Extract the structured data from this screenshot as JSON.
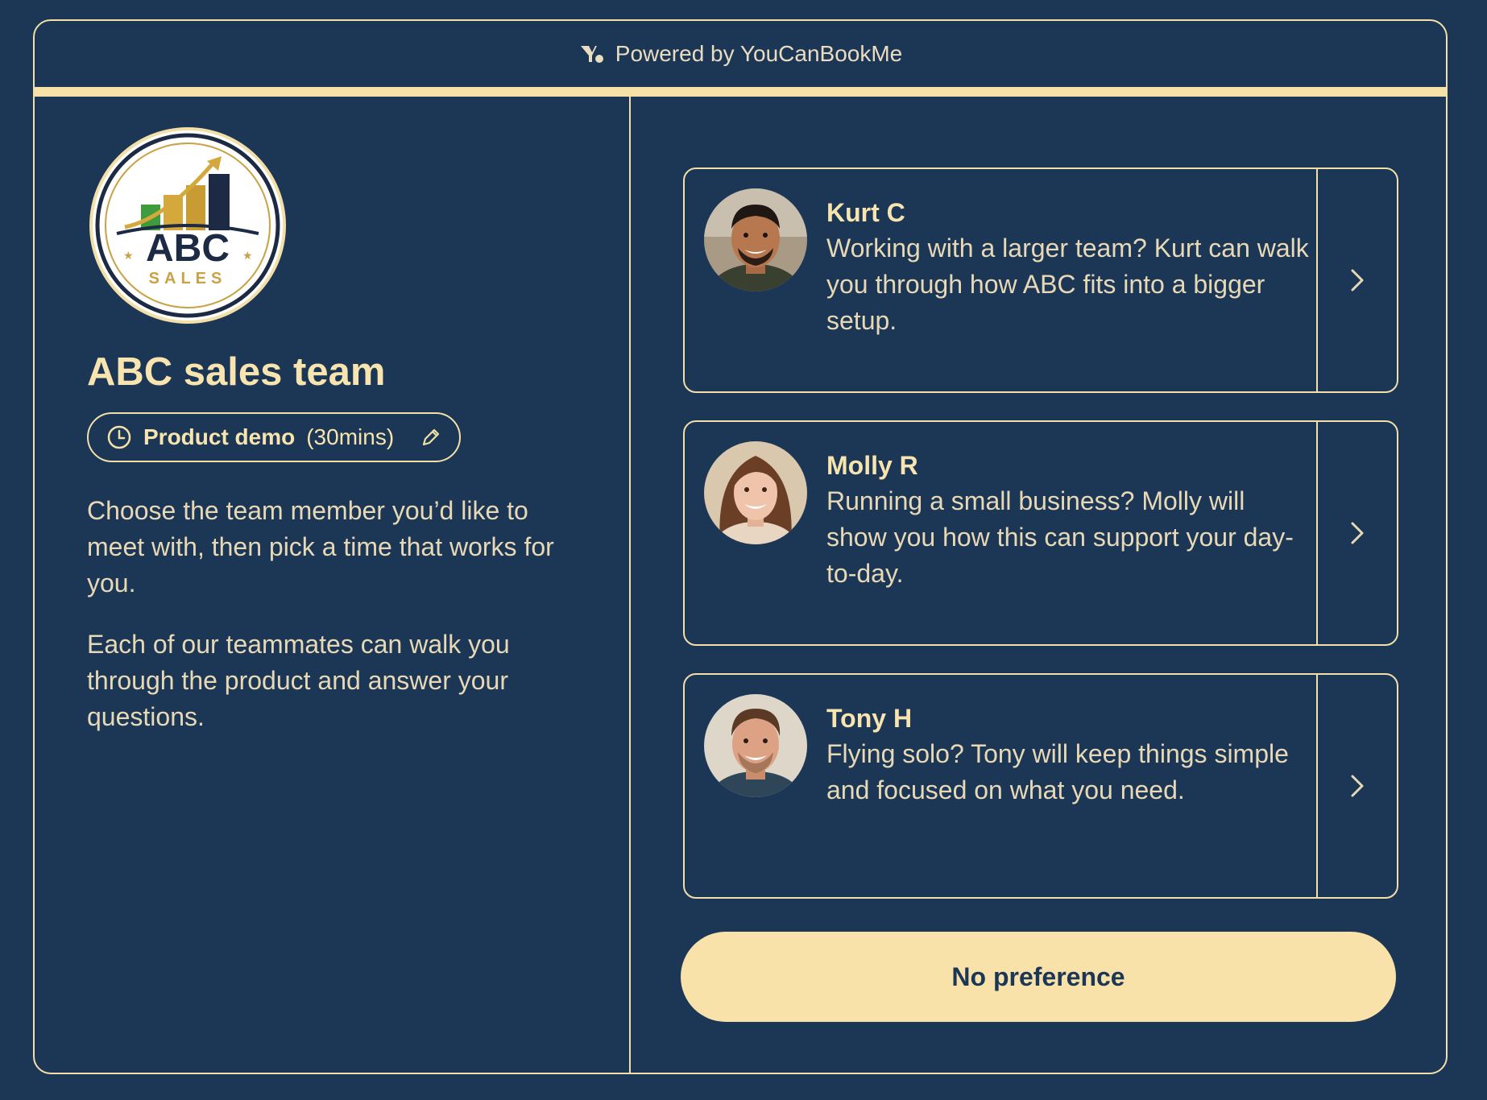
{
  "header": {
    "powered_by": "Powered by YouCanBookMe",
    "icon": "youcanbookme-logo-icon"
  },
  "brand": {
    "logo_text": "ABC",
    "logo_subtext": "SALES"
  },
  "left": {
    "title": "ABC sales team",
    "meeting_type": {
      "name": "Product demo",
      "duration": "(30mins)",
      "clock_icon": "clock-icon",
      "edit_icon": "pencil-icon"
    },
    "paragraph_1": "Choose the team member you’d like to meet with, then pick a time that works for you.",
    "paragraph_2": "Each of our teammates can walk you through the product and answer your questions."
  },
  "members": [
    {
      "name": "Kurt C",
      "description": "Working with a larger team? Kurt can walk you through how ABC fits into a bigger setup."
    },
    {
      "name": "Molly R",
      "description": "Running a small business? Molly will show you how this can support your day-to-day."
    },
    {
      "name": "Tony H",
      "description": "Flying solo? Tony will keep things simple and focused on what you need."
    }
  ],
  "actions": {
    "no_preference": "No preference"
  },
  "colors": {
    "background": "#1c3656",
    "accent": "#f6e2a9",
    "text": "#e8d9b6"
  }
}
